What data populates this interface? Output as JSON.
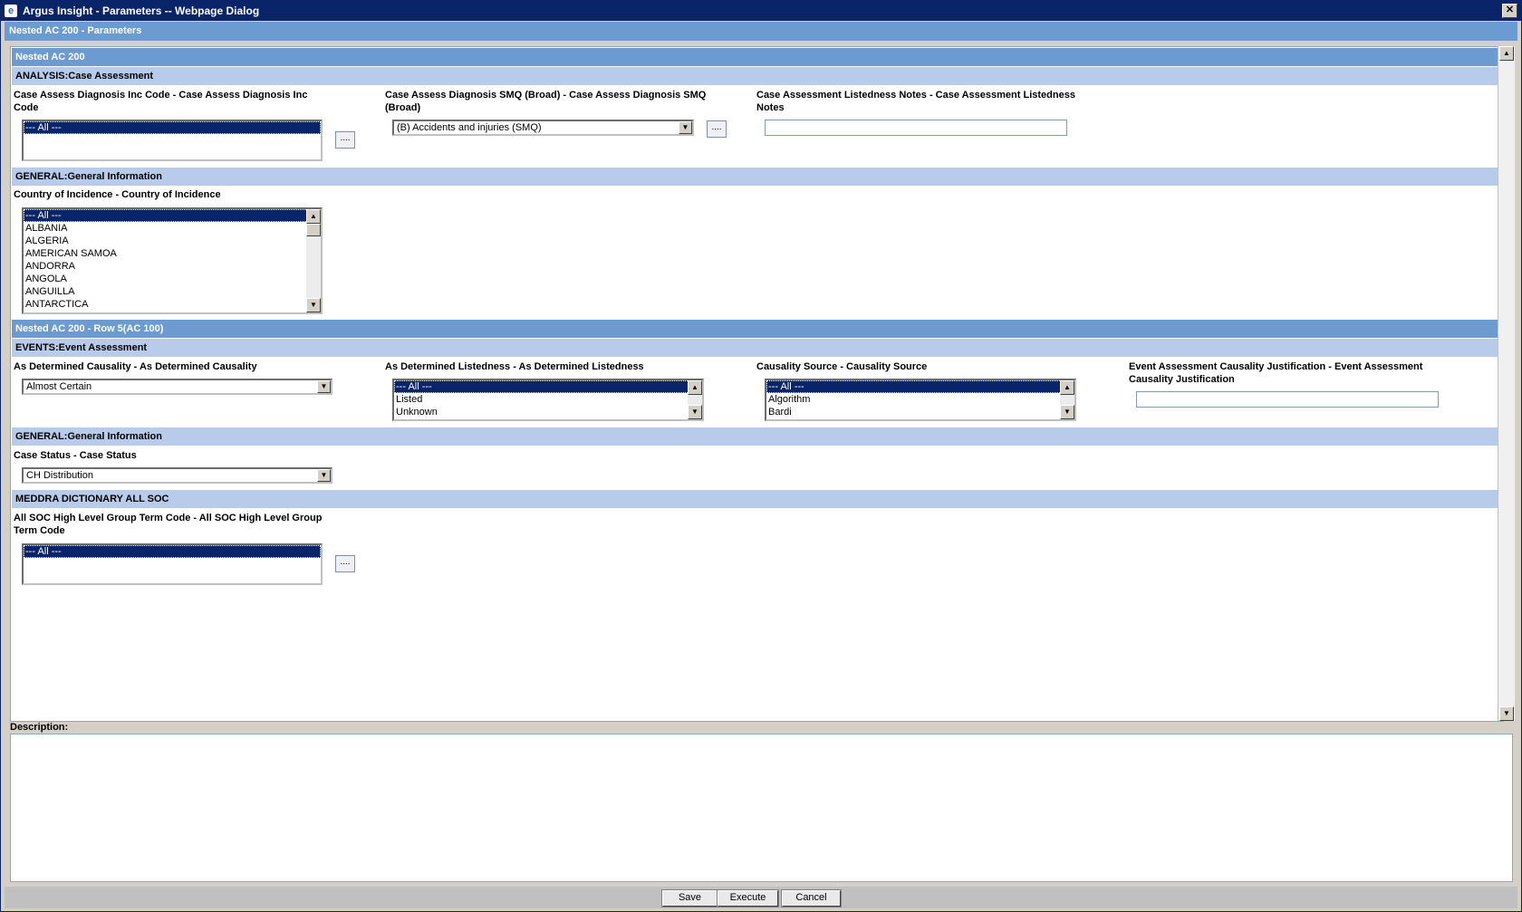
{
  "window": {
    "title": "Argus Insight - Parameters -- Webpage Dialog",
    "close_glyph": "✕"
  },
  "dialog": {
    "header": "Nested AC 200 - Parameters"
  },
  "sections": {
    "nested": "Nested AC 200",
    "analysis": "ANALYSIS:Case Assessment",
    "general1": "GENERAL:General Information",
    "nested_row": "Nested AC 200 - Row 5(AC 100)",
    "events": "EVENTS:Event Assessment",
    "general2": "GENERAL:General Information",
    "meddra": "MEDDRA DICTIONARY ALL SOC"
  },
  "analysis": {
    "inc_code_label": "Case Assess Diagnosis Inc Code - Case Assess Diagnosis Inc Code",
    "inc_code_options": [
      "--- All ---"
    ],
    "smq_label": "Case Assess Diagnosis SMQ (Broad) - Case Assess Diagnosis SMQ (Broad)",
    "smq_value": "(B) Accidents and injuries (SMQ)",
    "notes_label": "Case Assessment Listedness Notes - Case Assessment Listedness Notes",
    "notes_value": "",
    "ellipsis": "...."
  },
  "general": {
    "country_label": "Country of Incidence - Country of Incidence",
    "country_options": [
      "--- All ---",
      "ALBANIA",
      "ALGERIA",
      "AMERICAN SAMOA",
      "ANDORRA",
      "ANGOLA",
      "ANGUILLA",
      "ANTARCTICA"
    ]
  },
  "events": {
    "causality_label": "As Determined Causality - As Determined Causality",
    "causality_value": "Almost Certain",
    "listedness_label": "As Determined Listedness - As Determined Listedness",
    "listedness_options": [
      "--- All ---",
      "Listed",
      "Unknown"
    ],
    "source_label": "Causality Source - Causality Source",
    "source_options": [
      "--- All ---",
      "Algorithm",
      "Bardi"
    ],
    "justification_label": "Event Assessment Causality Justification - Event Assessment Causality Justification",
    "justification_value": ""
  },
  "case_status": {
    "label": "Case Status - Case Status",
    "value": "CH Distribution"
  },
  "meddra": {
    "label": "All SOC High Level Group Term Code - All SOC High Level Group Term Code",
    "options": [
      "--- All ---"
    ]
  },
  "description": {
    "label": "Description:",
    "value": ""
  },
  "buttons": {
    "save": "Save",
    "execute": "Execute",
    "cancel": "Cancel"
  },
  "icons": {
    "app": "ie-icon",
    "up": "▲",
    "down": "▼"
  }
}
